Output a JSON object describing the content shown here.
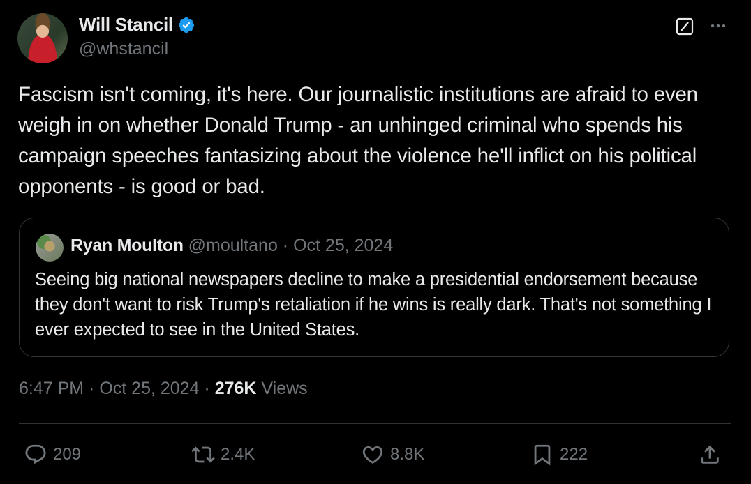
{
  "author": {
    "name": "Will Stancil",
    "handle": "@whstancil"
  },
  "tweet": {
    "text": "Fascism isn't coming, it's here. Our journalistic institutions are afraid to even weigh in on whether Donald Trump - an unhinged criminal who spends his campaign speeches fantasizing about the violence he'll inflict on his political opponents - is good or bad."
  },
  "quote": {
    "name": "Ryan Moulton",
    "handle": "@moultano",
    "separator": " · ",
    "date": "Oct 25, 2024",
    "text": "Seeing big national newspapers decline to make a presidential endorsement because they don't want to risk Trump's retaliation if he wins is really dark. That's not something I ever expected to see in the United States."
  },
  "meta": {
    "time": "6:47 PM",
    "sep1": " · ",
    "date": "Oct 25, 2024",
    "sep2": " · ",
    "views_count": "276K",
    "views_label": " Views"
  },
  "actions": {
    "replies": "209",
    "reposts": "2.4K",
    "likes": "8.8K",
    "bookmarks": "222"
  },
  "colors": {
    "background": "#000000",
    "text": "#e7e9ea",
    "secondary": "#71767b",
    "verified": "#1d9bf0",
    "border": "#2f3336"
  }
}
